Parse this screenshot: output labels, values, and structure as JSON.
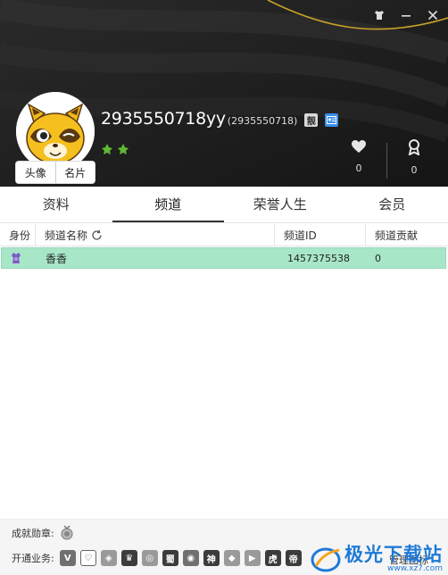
{
  "window": {
    "controls": [
      "skin-icon",
      "minimize-icon",
      "close-icon"
    ]
  },
  "profile": {
    "username": "2935550718yy",
    "user_id": "(2935550718)",
    "vip_badge": "靓",
    "avatar_tabs": [
      "头像",
      "名片"
    ],
    "likes_count": "0",
    "honor_count": "0"
  },
  "tabs": [
    "资料",
    "频道",
    "荣誉人生",
    "会员"
  ],
  "active_tab": 1,
  "table": {
    "headers": [
      "身份",
      "频道名称",
      "频道ID",
      "频道贡献"
    ],
    "rows": [
      {
        "role_icon": "crown-icon",
        "name": "香香",
        "id": "1457375538",
        "contribution": "0"
      }
    ]
  },
  "footer": {
    "achievements_label": "成就勋章:",
    "services_label": "开通业务:",
    "service_icons": [
      "V",
      "♡",
      "◈",
      "♛",
      "◎",
      "蜀",
      "◉",
      "神",
      "◆",
      "▶",
      "虎",
      "帝"
    ],
    "manage_label": "管理图标"
  },
  "watermark": {
    "text": "极光下载站",
    "sub": "www.xz7.com"
  },
  "colors": {
    "header_bg": "#1f1f1f",
    "accent_gold": "#c9a227",
    "row_selected": "#a8e6c8",
    "watermark_blue": "#1e7ad6"
  }
}
